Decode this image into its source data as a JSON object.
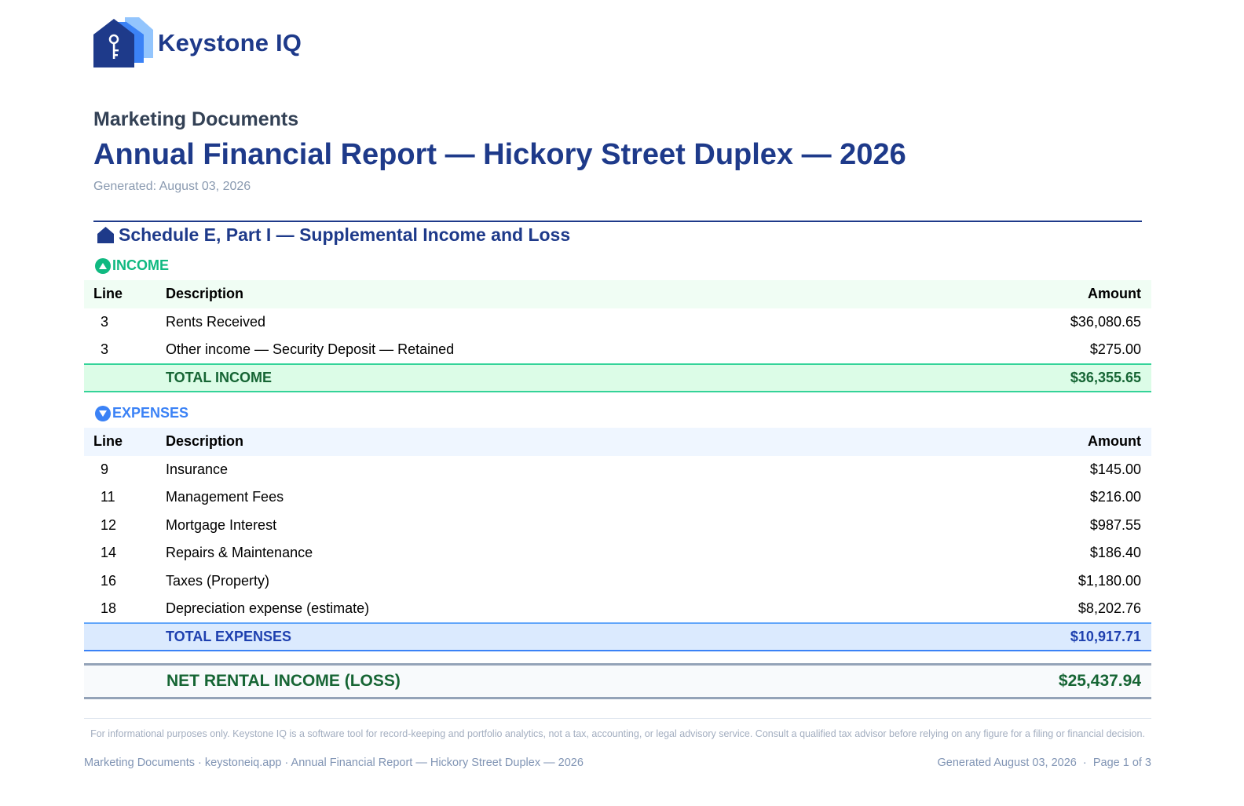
{
  "brand": {
    "name": "Keystone IQ"
  },
  "header": {
    "section": "Marketing Documents",
    "title": "Annual Financial Report — Hickory Street Duplex — 2026",
    "generated": "Generated: August 03, 2026"
  },
  "schedule": {
    "title": "Schedule E, Part I — Supplemental Income and Loss"
  },
  "income": {
    "heading": "INCOME",
    "columns": {
      "line": "Line",
      "description": "Description",
      "amount": "Amount"
    },
    "rows": [
      {
        "line": "3",
        "description": "Rents Received",
        "amount": "$36,080.65"
      },
      {
        "line": "3",
        "description": "Other income — Security Deposit — Retained",
        "amount": "$275.00"
      }
    ],
    "total": {
      "label": "TOTAL INCOME",
      "amount": "$36,355.65"
    }
  },
  "expenses": {
    "heading": "EXPENSES",
    "columns": {
      "line": "Line",
      "description": "Description",
      "amount": "Amount"
    },
    "rows": [
      {
        "line": "9",
        "description": "Insurance",
        "amount": "$145.00"
      },
      {
        "line": "11",
        "description": "Management Fees",
        "amount": "$216.00"
      },
      {
        "line": "12",
        "description": "Mortgage Interest",
        "amount": "$987.55"
      },
      {
        "line": "14",
        "description": "Repairs & Maintenance",
        "amount": "$186.40"
      },
      {
        "line": "16",
        "description": "Taxes (Property)",
        "amount": "$1,180.00"
      },
      {
        "line": "18",
        "description": "Depreciation expense (estimate)",
        "amount": "$8,202.76"
      }
    ],
    "total": {
      "label": "TOTAL EXPENSES",
      "amount": "$10,917.71"
    }
  },
  "net": {
    "label": "NET RENTAL INCOME (LOSS)",
    "amount": "$25,437.94"
  },
  "footer": {
    "disclaimer": "For informational purposes only. Keystone IQ is a software tool for record-keeping and portfolio analytics, not a tax, accounting, or legal advisory service. Consult a qualified tax advisor before relying on any figure for a filing or financial decision.",
    "left": "Marketing Documents · keystoneiq.app · Annual Financial Report — Hickory Street Duplex — 2026",
    "generated": "Generated August 03, 2026",
    "page": "Page 1 of 3"
  },
  "colors": {
    "brand_navy": "#1e3a8a",
    "income_green": "#10b981",
    "income_total_text": "#166534",
    "expenses_blue": "#3b82f6",
    "expenses_total_text": "#1e40af"
  },
  "icons": {
    "logo": "house-key-logo-icon",
    "schedule": "house-icon",
    "income": "arrow-up-circle-icon",
    "expenses": "arrow-down-circle-icon"
  }
}
